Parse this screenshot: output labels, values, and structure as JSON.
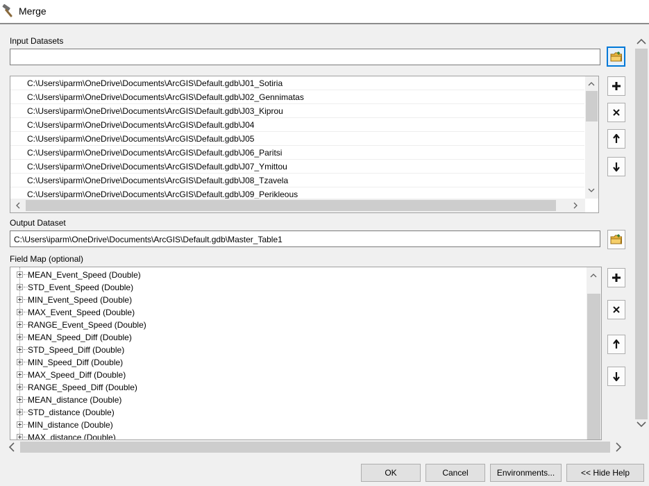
{
  "window": {
    "title": "Merge",
    "title_icon": "hammer-icon"
  },
  "input_datasets": {
    "label": "Input Datasets",
    "value": "",
    "items": [
      "C:\\Users\\iparm\\OneDrive\\Documents\\ArcGIS\\Default.gdb\\J01_Sotiria",
      "C:\\Users\\iparm\\OneDrive\\Documents\\ArcGIS\\Default.gdb\\J02_Gennimatas",
      "C:\\Users\\iparm\\OneDrive\\Documents\\ArcGIS\\Default.gdb\\J03_Kiprou",
      "C:\\Users\\iparm\\OneDrive\\Documents\\ArcGIS\\Default.gdb\\J04",
      "C:\\Users\\iparm\\OneDrive\\Documents\\ArcGIS\\Default.gdb\\J05",
      "C:\\Users\\iparm\\OneDrive\\Documents\\ArcGIS\\Default.gdb\\J06_Paritsi",
      "C:\\Users\\iparm\\OneDrive\\Documents\\ArcGIS\\Default.gdb\\J07_Ymittou",
      "C:\\Users\\iparm\\OneDrive\\Documents\\ArcGIS\\Default.gdb\\J08_Tzavela",
      "C:\\Users\\iparm\\OneDrive\\Documents\\ArcGIS\\Default.gdb\\J09_Perikleous"
    ],
    "buttons": [
      "browse-folder-icon",
      "plus-icon",
      "cross-icon",
      "arrow-up-icon",
      "arrow-down-icon"
    ]
  },
  "output_dataset": {
    "label": "Output Dataset",
    "value": "C:\\Users\\iparm\\OneDrive\\Documents\\ArcGIS\\Default.gdb\\Master_Table1"
  },
  "field_map": {
    "label": "Field Map (optional)",
    "fields": [
      "MEAN_Event_Speed (Double)",
      "STD_Event_Speed (Double)",
      "MIN_Event_Speed (Double)",
      "MAX_Event_Speed (Double)",
      "RANGE_Event_Speed (Double)",
      "MEAN_Speed_Diff (Double)",
      "STD_Speed_Diff (Double)",
      "MIN_Speed_Diff (Double)",
      "MAX_Speed_Diff (Double)",
      "RANGE_Speed_Diff (Double)",
      "MEAN_distance (Double)",
      "STD_distance (Double)",
      "MIN_distance (Double)",
      "MAX_distance (Double)"
    ]
  },
  "footer": {
    "ok": "OK",
    "cancel": "Cancel",
    "environments": "Environments...",
    "hide_help": "<< Hide Help"
  },
  "colors": {
    "focus_border": "#0078d7",
    "folder_yellow": "#e8b43c"
  }
}
